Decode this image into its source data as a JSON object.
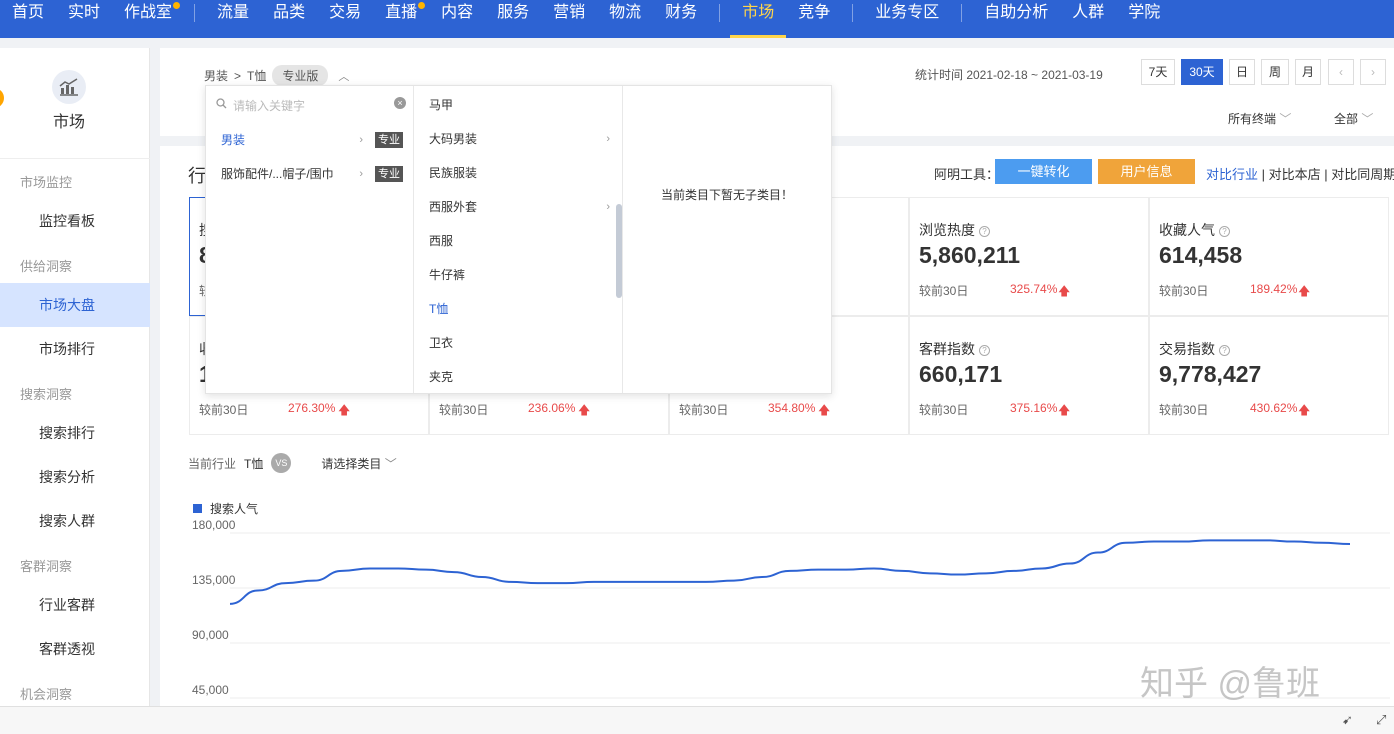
{
  "nav": {
    "items": [
      "首页",
      "实时",
      "作战室",
      "流量",
      "品类",
      "交易",
      "直播",
      "内容",
      "服务",
      "营销",
      "物流",
      "财务",
      "市场",
      "竞争",
      "业务专区",
      "自助分析",
      "人群",
      "学院"
    ],
    "active": "市场"
  },
  "sidebar": {
    "title": "市场",
    "groups": [
      {
        "label": "市场监控",
        "items": [
          "监控看板"
        ]
      },
      {
        "label": "供给洞察",
        "items": [
          "市场大盘",
          "市场排行"
        ]
      },
      {
        "label": "搜索洞察",
        "items": [
          "搜索排行",
          "搜索分析",
          "搜索人群"
        ]
      },
      {
        "label": "客群洞察",
        "items": [
          "行业客群",
          "客群透视"
        ]
      },
      {
        "label": "机会洞察",
        "items": []
      }
    ],
    "active_item": "市场大盘"
  },
  "header": {
    "breadcrumb_cat": "男装",
    "breadcrumb_sub": "T恤",
    "edition_badge": "专业版",
    "stat_time": "统计时间 2021-02-18 ~ 2021-03-19",
    "range_buttons": [
      "7天",
      "30天",
      "日",
      "周",
      "月"
    ],
    "active_range": "30天",
    "terminal_filter": "所有终端",
    "all_filter": "全部"
  },
  "section": {
    "title_partial": "行",
    "tool_label": "阿明工具：",
    "tool_btn1": "一键转化",
    "tool_btn2": "用户信息",
    "link1": "对比行业",
    "link2": "对比本店",
    "link3": "对比同周期",
    "colors": {
      "tool_blue": "#4c9cf0",
      "tool_orange": "#f0a43a"
    }
  },
  "metrics": {
    "partial_labels": {
      "r1c1": "搜",
      "r1c1_value": "8",
      "r1c1_cmp": "较",
      "r2c1": "收",
      "r2c1_value": "1"
    },
    "cards": [
      {
        "label": "浏览热度",
        "value": "5,860,211",
        "cmp": "较前30日",
        "pct": "325.74%"
      },
      {
        "label": "收藏人气",
        "value": "614,458",
        "cmp": "较前30日",
        "pct": "189.42%"
      },
      {
        "label": "客群指数",
        "value": "660,171",
        "cmp": "较前30日",
        "pct": "375.16%"
      },
      {
        "label": "交易指数",
        "value": "9,778,427",
        "cmp": "较前30日",
        "pct": "430.62%"
      }
    ],
    "row2_partial": [
      {
        "cmp": "较前30日",
        "pct": "276.30%"
      },
      {
        "cmp": "较前30日",
        "pct": "236.06%"
      },
      {
        "cmp": "较前30日",
        "pct": "354.80%"
      }
    ]
  },
  "compare": {
    "current_label": "当前行业",
    "current_value": "T恤",
    "vs": "VS",
    "select_placeholder": "请选择类目"
  },
  "chart_data": {
    "type": "line",
    "series": [
      {
        "name": "搜索人气",
        "color": "#2d63d3",
        "values": [
          122000,
          133000,
          139000,
          141000,
          149000,
          151000,
          151000,
          150000,
          148000,
          144000,
          140000,
          139000,
          139000,
          140000,
          140000,
          140000,
          140000,
          140000,
          141000,
          144000,
          149000,
          150000,
          150000,
          151000,
          149000,
          147000,
          146000,
          147000,
          149000,
          151000,
          155000,
          164000,
          172000,
          173000,
          173000,
          174000,
          174000,
          174000,
          173000,
          172000,
          171000
        ]
      }
    ],
    "yticks": [
      "180,000",
      "135,000",
      "90,000",
      "45,000"
    ],
    "ylim": [
      45000,
      180000
    ]
  },
  "dropdown": {
    "search_placeholder": "请输入关键字",
    "level1": [
      {
        "label": "男装",
        "tag": "专业",
        "selected": true
      },
      {
        "label": "服饰配件/...帽子/围巾",
        "tag": "专业",
        "selected": false
      }
    ],
    "level2": [
      {
        "label": "马甲",
        "has_children": false
      },
      {
        "label": "大码男装",
        "has_children": true
      },
      {
        "label": "民族服装",
        "has_children": false
      },
      {
        "label": "西服外套",
        "has_children": true
      },
      {
        "label": "西服",
        "has_children": false
      },
      {
        "label": "牛仔裤",
        "has_children": false
      },
      {
        "label": "T恤",
        "has_children": false,
        "selected": true
      },
      {
        "label": "卫衣",
        "has_children": false
      },
      {
        "label": "夹克",
        "has_children": false
      }
    ],
    "empty_text": "当前类目下暂无子类目！"
  },
  "watermark": "知乎 @鲁班"
}
